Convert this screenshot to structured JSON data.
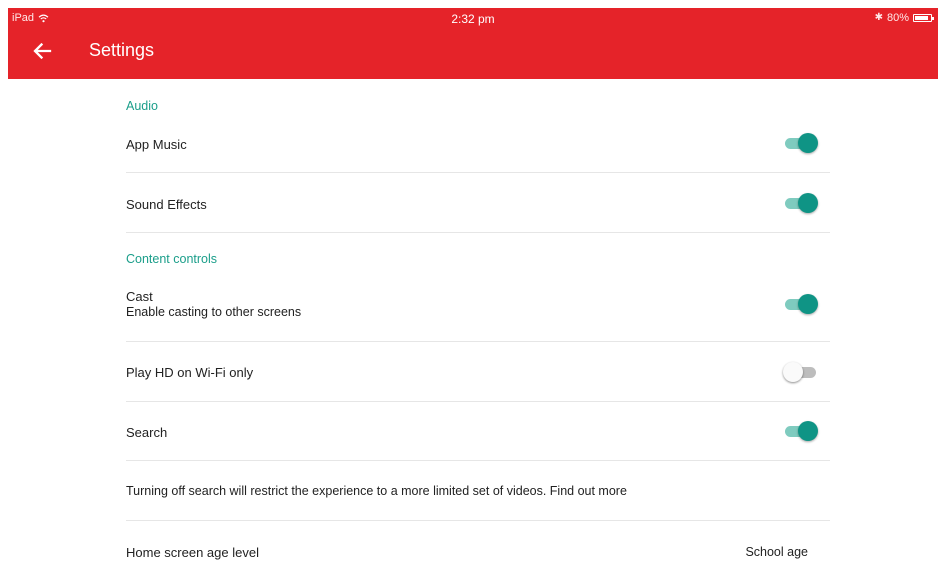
{
  "status_bar": {
    "device": "iPad",
    "time": "2:32 pm",
    "battery": "80%"
  },
  "header": {
    "title": "Settings"
  },
  "sections": {
    "audio": {
      "header": "Audio",
      "app_music": {
        "label": "App Music",
        "enabled": true
      },
      "sound_effects": {
        "label": "Sound Effects",
        "enabled": true
      }
    },
    "content_controls": {
      "header": "Content controls",
      "cast": {
        "label": "Cast",
        "subtitle": "Enable casting to other screens",
        "enabled": true
      },
      "play_hd": {
        "label": "Play HD on Wi-Fi only",
        "enabled": false
      },
      "search": {
        "label": "Search",
        "enabled": true
      },
      "search_info": "Turning off search will restrict the experience to a more limited set of videos. Find out more",
      "age_level": {
        "label": "Home screen age level",
        "value": "School age"
      }
    }
  },
  "colors": {
    "app_bar": "#e52329",
    "accent": "#1b9e8a",
    "toggle_on_thumb": "#0f9485",
    "toggle_on_track": "#7fcbbf",
    "toggle_off_track": "#bdbdbd"
  }
}
